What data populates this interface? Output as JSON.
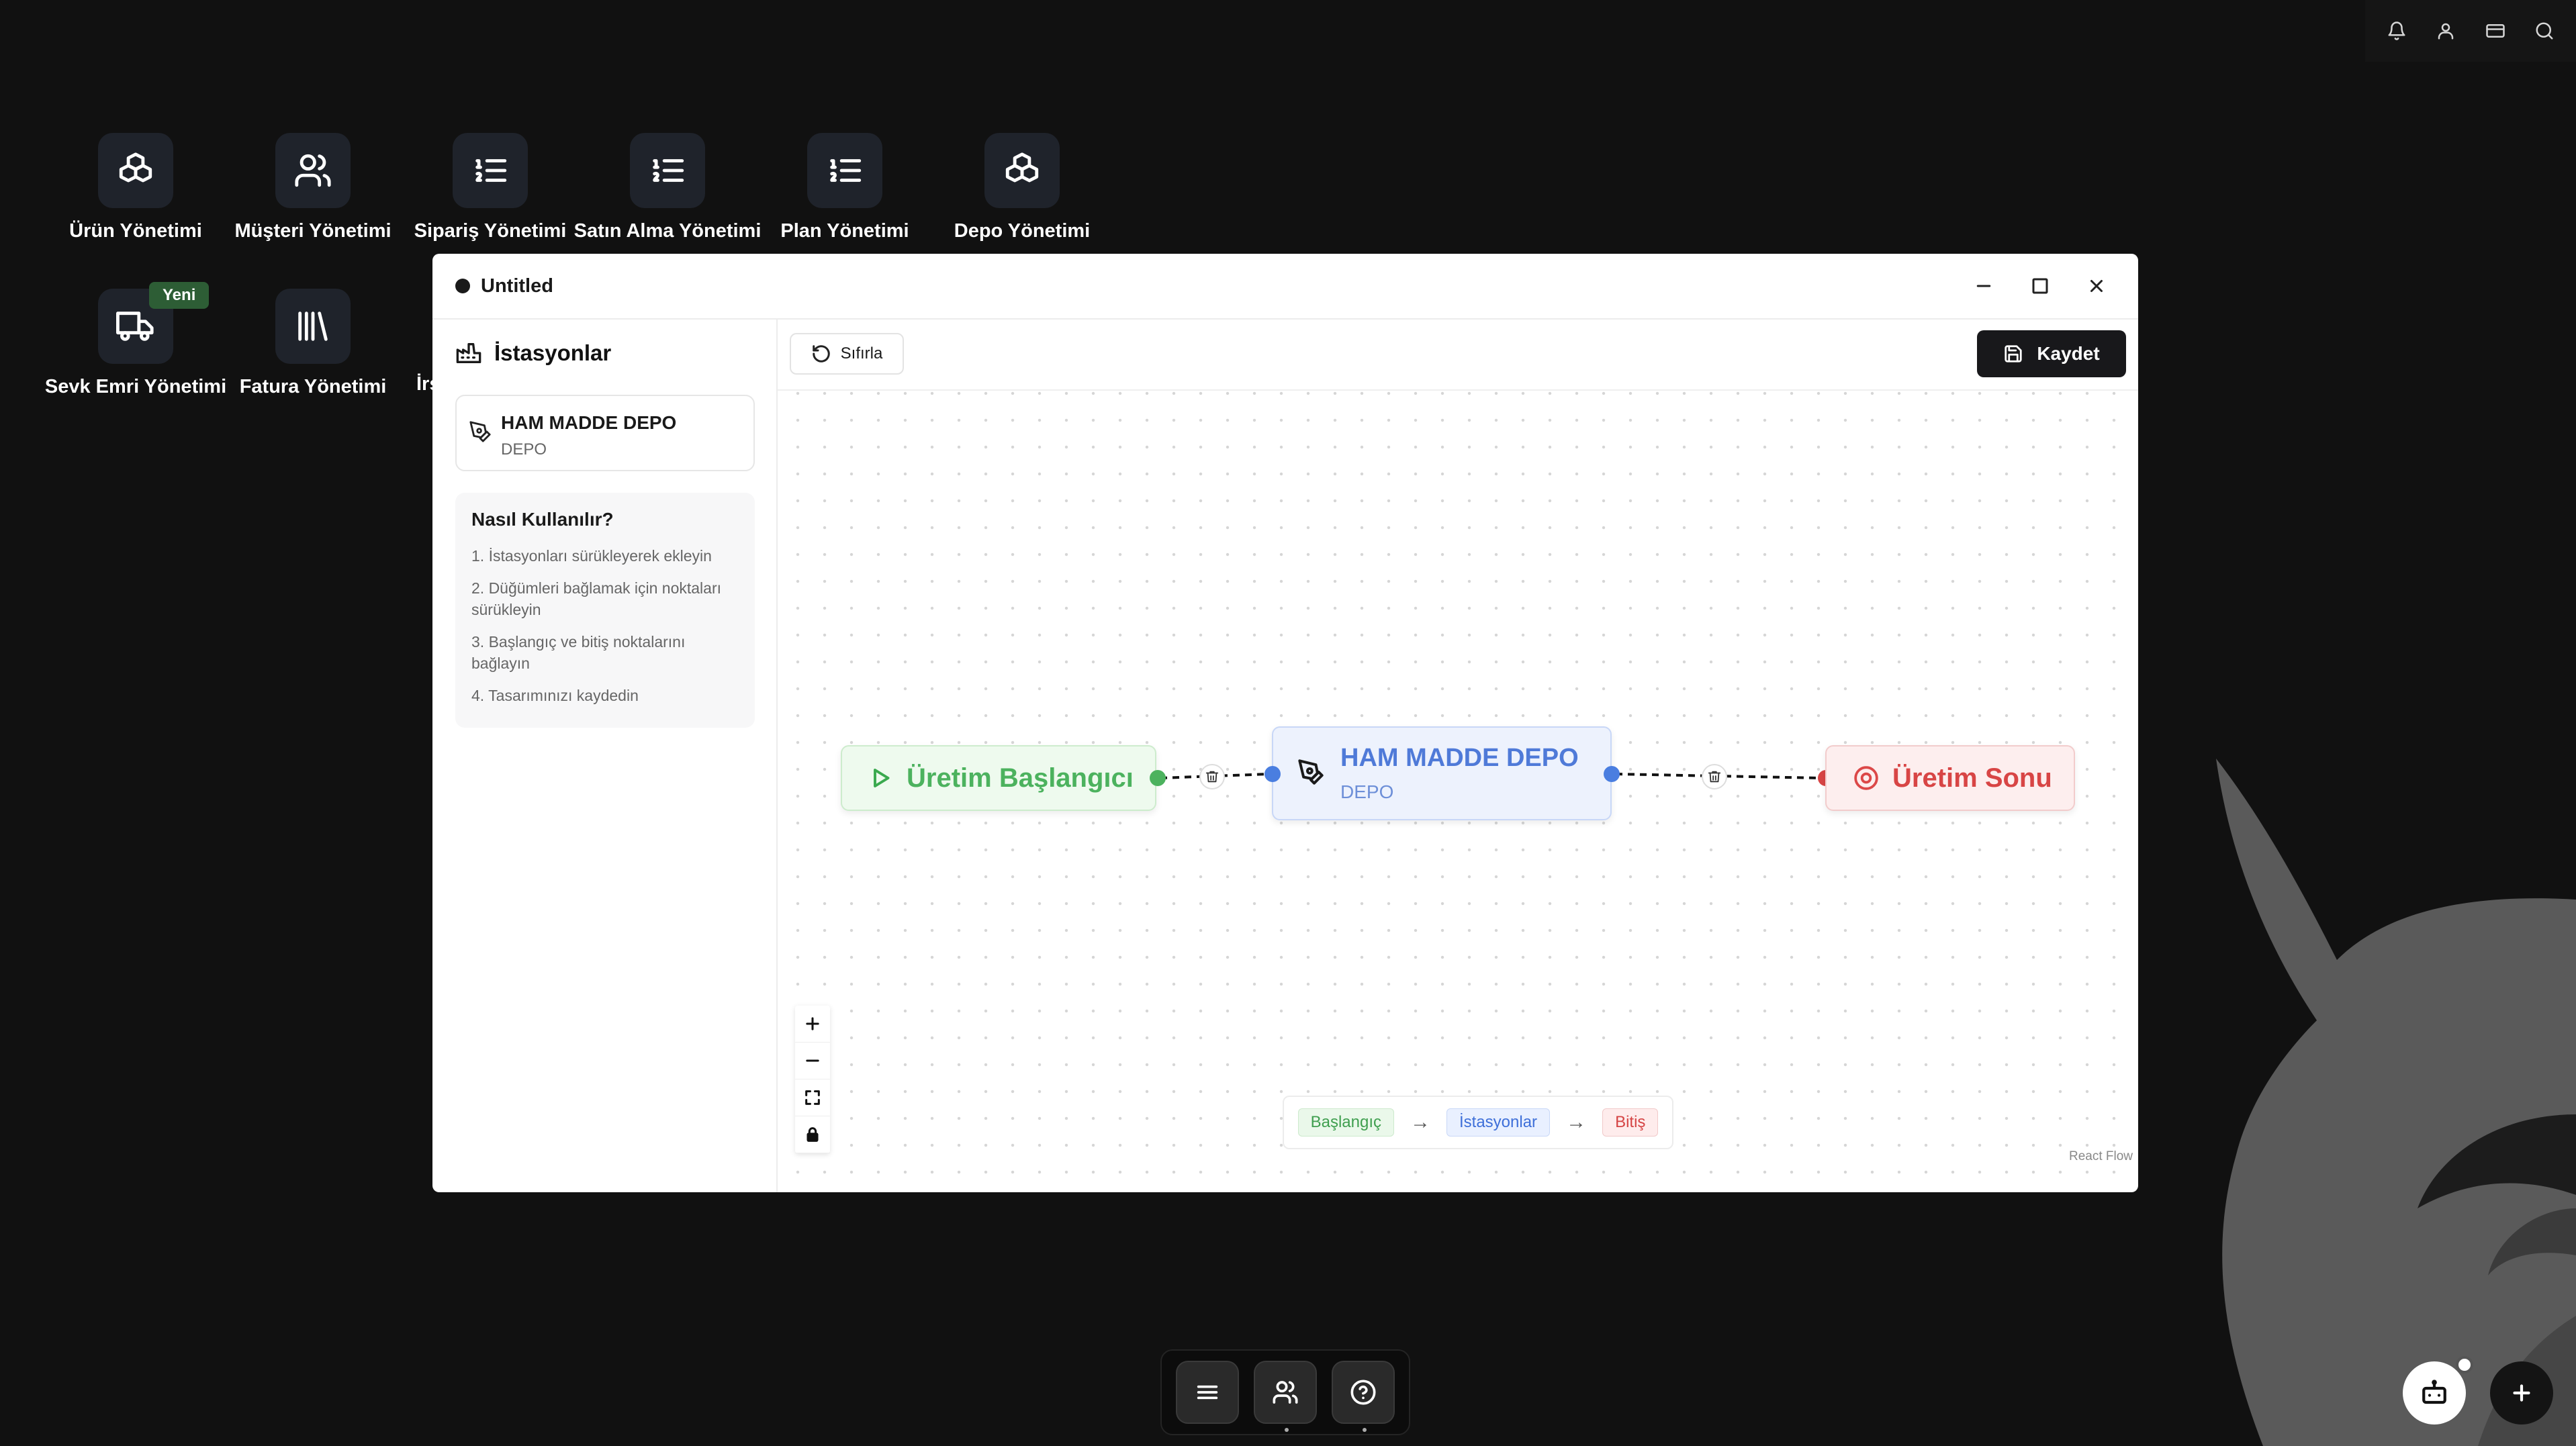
{
  "desktop": {
    "icons": [
      {
        "label": "Ürün Yönetimi",
        "icon": "boxes-icon"
      },
      {
        "label": "Müşteri Yönetimi",
        "icon": "users-icon"
      },
      {
        "label": "Sipariş Yönetimi",
        "icon": "list-ordered-icon"
      },
      {
        "label": "Satın Alma Yönetimi",
        "icon": "list-ordered-icon"
      },
      {
        "label": "Plan Yönetimi",
        "icon": "list-ordered-icon"
      },
      {
        "label": "Depo Yönetimi",
        "icon": "boxes-icon"
      },
      {
        "label": "Sevk Emri Yönetimi",
        "icon": "truck-icon",
        "badge": "Yeni"
      },
      {
        "label": "Fatura Yönetimi",
        "icon": "library-icon"
      },
      {
        "label": "İrs",
        "icon": "partially-hidden"
      }
    ]
  },
  "tray": [
    "bell-icon",
    "user-icon",
    "credit-card-icon",
    "search-icon"
  ],
  "window": {
    "title": "Untitled",
    "sidebar": {
      "heading": "İstasyonlar",
      "stations": [
        {
          "name": "HAM MADDE DEPO",
          "type": "DEPO"
        }
      ],
      "howto": {
        "title": "Nasıl Kullanılır?",
        "items": [
          "1. İstasyonları sürükleyerek ekleyin",
          "2. Düğümleri bağlamak için noktaları sürükleyin",
          "3. Başlangıç ve bitiş noktalarını bağlayın",
          "4. Tasarımınızı kaydedin"
        ]
      }
    },
    "toolbar": {
      "reset_label": "Sıfırla",
      "save_label": "Kaydet"
    },
    "flow": {
      "start_label": "Üretim Başlangıcı",
      "station_name": "HAM MADDE DEPO",
      "station_type": "DEPO",
      "end_label": "Üretim Sonu"
    },
    "legend": {
      "start": "Başlangıç",
      "stations": "İstasyonlar",
      "end": "Bitiş",
      "arrow": "→"
    },
    "attribution": "React Flow"
  },
  "colors": {
    "start": "#4cb25e",
    "station": "#4f7ad8",
    "end": "#d84545",
    "background": "#111111"
  }
}
